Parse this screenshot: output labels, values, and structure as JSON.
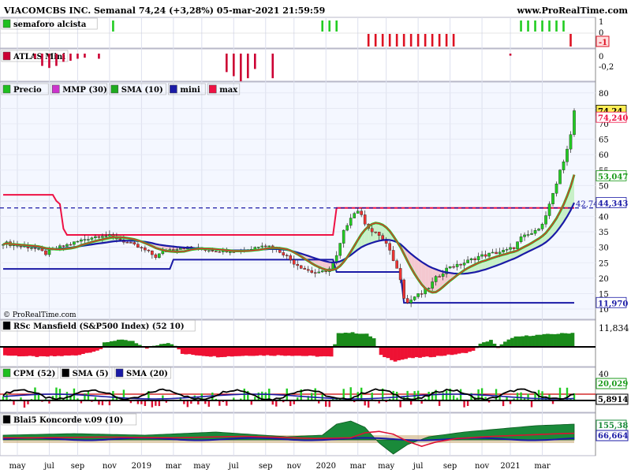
{
  "header": {
    "title": "VIACOMCBS INC. Semanal 74,24 (+3,28%) 05-mar-2021 21:59:59",
    "website": "www.ProRealTime.com",
    "copyright": "© ProRealTime.com"
  },
  "x_axis": {
    "labels": [
      "may",
      "jul",
      "sep",
      "nov",
      "2019",
      "mar",
      "may",
      "jul",
      "sep",
      "nov",
      "2020",
      "mar",
      "may",
      "jul",
      "sep",
      "nov",
      "2021",
      "mar"
    ]
  },
  "chart_data": [
    {
      "id": "semaforo",
      "type": "bar",
      "legend": [
        {
          "name": "semaforo alcista",
          "color": "#1fbf1f"
        }
      ],
      "y_ticks": [
        "1",
        "0",
        "-1"
      ],
      "last_value_label": "-1",
      "green_bars_at_week": [
        31,
        90,
        92,
        94,
        146,
        148,
        150,
        152,
        154,
        156,
        158
      ],
      "red_bars_at_week": [
        103,
        105,
        107,
        109,
        111,
        113,
        115,
        117,
        119,
        121,
        123,
        125,
        127,
        160
      ]
    },
    {
      "id": "atlas",
      "type": "bar",
      "legend": [
        {
          "name": "ATLAS Mini",
          "color": "#cc0033"
        }
      ],
      "y_ticks": [
        "0",
        "-0,2"
      ],
      "last_value_label": "0",
      "bars": [
        {
          "week": 9,
          "value": -0.05
        },
        {
          "week": 11,
          "value": -0.12
        },
        {
          "week": 13,
          "value": -0.14
        },
        {
          "week": 15,
          "value": -0.12
        },
        {
          "week": 17,
          "value": -0.08
        },
        {
          "week": 19,
          "value": -0.07
        },
        {
          "week": 21,
          "value": -0.05
        },
        {
          "week": 23,
          "value": -0.04
        },
        {
          "week": 27,
          "value": -0.05
        },
        {
          "week": 63,
          "value": -0.18
        },
        {
          "week": 65,
          "value": -0.22
        },
        {
          "week": 67,
          "value": -0.27
        },
        {
          "week": 69,
          "value": -0.24
        },
        {
          "week": 71,
          "value": -0.15
        },
        {
          "week": 76,
          "value": -0.24
        },
        {
          "week": 143,
          "value": -0.02
        }
      ]
    },
    {
      "id": "price",
      "type": "candlestick",
      "legend": [
        {
          "name": "Precio",
          "color": "#1fbf1f"
        },
        {
          "name": "MMP (30)",
          "color": "#cc33cc"
        },
        {
          "name": "SMA (10)",
          "color": "#1faa1f"
        },
        {
          "name": "mini",
          "color": "#1a1aa6"
        },
        {
          "name": "max",
          "color": "#ee1144"
        }
      ],
      "y_ticks": [
        "80",
        "75",
        "70",
        "65",
        "60",
        "55",
        "50",
        "45",
        "40",
        "35",
        "30",
        "25",
        "20",
        "15",
        "10"
      ],
      "ylim": [
        10,
        82
      ],
      "value_labels": [
        "74,24",
        "74,240",
        "53,047",
        "44,343",
        "11,970"
      ],
      "level_label": "42,74",
      "level_value": 42.74,
      "close_anchors": [
        [
          0,
          31.5
        ],
        [
          4,
          30.5
        ],
        [
          8,
          30
        ],
        [
          12,
          28
        ],
        [
          16,
          30
        ],
        [
          20,
          31.5
        ],
        [
          24,
          33
        ],
        [
          28,
          34
        ],
        [
          32,
          33
        ],
        [
          36,
          31
        ],
        [
          40,
          29
        ],
        [
          43,
          27
        ],
        [
          46,
          29
        ],
        [
          50,
          30
        ],
        [
          55,
          29.5
        ],
        [
          60,
          29
        ],
        [
          65,
          29
        ],
        [
          70,
          29.5
        ],
        [
          73,
          31
        ],
        [
          76,
          30
        ],
        [
          79,
          28
        ],
        [
          82,
          25
        ],
        [
          85,
          23
        ],
        [
          87,
          22
        ],
        [
          89,
          21.5
        ],
        [
          92,
          23
        ],
        [
          94,
          27
        ],
        [
          96,
          35
        ],
        [
          98,
          40
        ],
        [
          100,
          42
        ],
        [
          102,
          38
        ],
        [
          104,
          35
        ],
        [
          106,
          34
        ],
        [
          108,
          31
        ],
        [
          110,
          26
        ],
        [
          112,
          20
        ],
        [
          113,
          14
        ],
        [
          114,
          12
        ],
        [
          116,
          14
        ],
        [
          118,
          15
        ],
        [
          120,
          17
        ],
        [
          122,
          20
        ],
        [
          124,
          22
        ],
        [
          126,
          24
        ],
        [
          128,
          24
        ],
        [
          130,
          25
        ],
        [
          134,
          27
        ],
        [
          138,
          28
        ],
        [
          142,
          29
        ],
        [
          144,
          30
        ],
        [
          146,
          33
        ],
        [
          148,
          34
        ],
        [
          150,
          35
        ],
        [
          152,
          38
        ],
        [
          153,
          40
        ],
        [
          154,
          44
        ],
        [
          156,
          50
        ],
        [
          157,
          55
        ],
        [
          158,
          58
        ],
        [
          159,
          62
        ],
        [
          160,
          66
        ],
        [
          161,
          74.24
        ]
      ],
      "max_steps": [
        [
          0,
          47
        ],
        [
          14,
          47
        ],
        [
          15,
          45
        ],
        [
          16,
          44
        ],
        [
          17,
          36
        ],
        [
          18,
          34
        ],
        [
          93,
          34
        ],
        [
          94,
          42.74
        ],
        [
          161,
          42.74
        ]
      ],
      "mini_steps": [
        [
          0,
          23
        ],
        [
          47,
          23
        ],
        [
          48,
          26
        ],
        [
          93,
          26
        ],
        [
          94,
          22
        ],
        [
          112,
          22
        ],
        [
          113,
          12
        ],
        [
          161,
          12
        ]
      ]
    },
    {
      "id": "mansfield",
      "type": "area",
      "legend": [
        {
          "name": "RSc Mansfield (S&P500 Index) (52 10)",
          "color": "#000000"
        }
      ],
      "last_value_label": "11,834",
      "anchors": [
        [
          0,
          -0.6
        ],
        [
          10,
          -0.7
        ],
        [
          20,
          -0.6
        ],
        [
          27,
          -0.2
        ],
        [
          28,
          0.3
        ],
        [
          32,
          0.5
        ],
        [
          36,
          0.4
        ],
        [
          38,
          0.1
        ],
        [
          40,
          -0.1
        ],
        [
          44,
          0.2
        ],
        [
          46,
          0.3
        ],
        [
          48,
          0.1
        ],
        [
          50,
          -0.5
        ],
        [
          60,
          -0.7
        ],
        [
          70,
          -0.6
        ],
        [
          80,
          -0.6
        ],
        [
          92,
          -0.7
        ],
        [
          94,
          1.0
        ],
        [
          98,
          1.0
        ],
        [
          102,
          0.9
        ],
        [
          104,
          0.6
        ],
        [
          106,
          -0.6
        ],
        [
          110,
          -1.0
        ],
        [
          114,
          -0.8
        ],
        [
          120,
          -0.7
        ],
        [
          128,
          -0.5
        ],
        [
          132,
          -0.3
        ],
        [
          134,
          0.2
        ],
        [
          137,
          0.5
        ],
        [
          139,
          -0.1
        ],
        [
          141,
          0.4
        ],
        [
          144,
          0.7
        ],
        [
          148,
          0.8
        ],
        [
          154,
          0.9
        ],
        [
          161,
          1.0
        ]
      ]
    },
    {
      "id": "cpm",
      "type": "bar",
      "legend": [
        {
          "name": "CPM (52)",
          "color": "#1fbf1f"
        },
        {
          "name": "SMA (5)",
          "color": "#000000"
        },
        {
          "name": "SMA (20)",
          "color": "#1a1aa6"
        }
      ],
      "y_ticks": [
        "40"
      ],
      "value_labels": [
        "20,029",
        "5,8914"
      ]
    },
    {
      "id": "koncorde",
      "type": "area",
      "legend": [
        {
          "name": "Blai5 Koncorde v.09 (10)",
          "color": "#000000"
        }
      ],
      "value_labels": [
        "155,38",
        "66,664"
      ],
      "green_anchors": [
        [
          0,
          3
        ],
        [
          20,
          4
        ],
        [
          40,
          3
        ],
        [
          60,
          5
        ],
        [
          80,
          2
        ],
        [
          90,
          3
        ],
        [
          94,
          10
        ],
        [
          98,
          12
        ],
        [
          102,
          8
        ],
        [
          106,
          -2
        ],
        [
          110,
          -9
        ],
        [
          114,
          -3
        ],
        [
          120,
          2
        ],
        [
          130,
          5
        ],
        [
          140,
          7
        ],
        [
          150,
          9
        ],
        [
          161,
          10
        ]
      ]
    }
  ]
}
